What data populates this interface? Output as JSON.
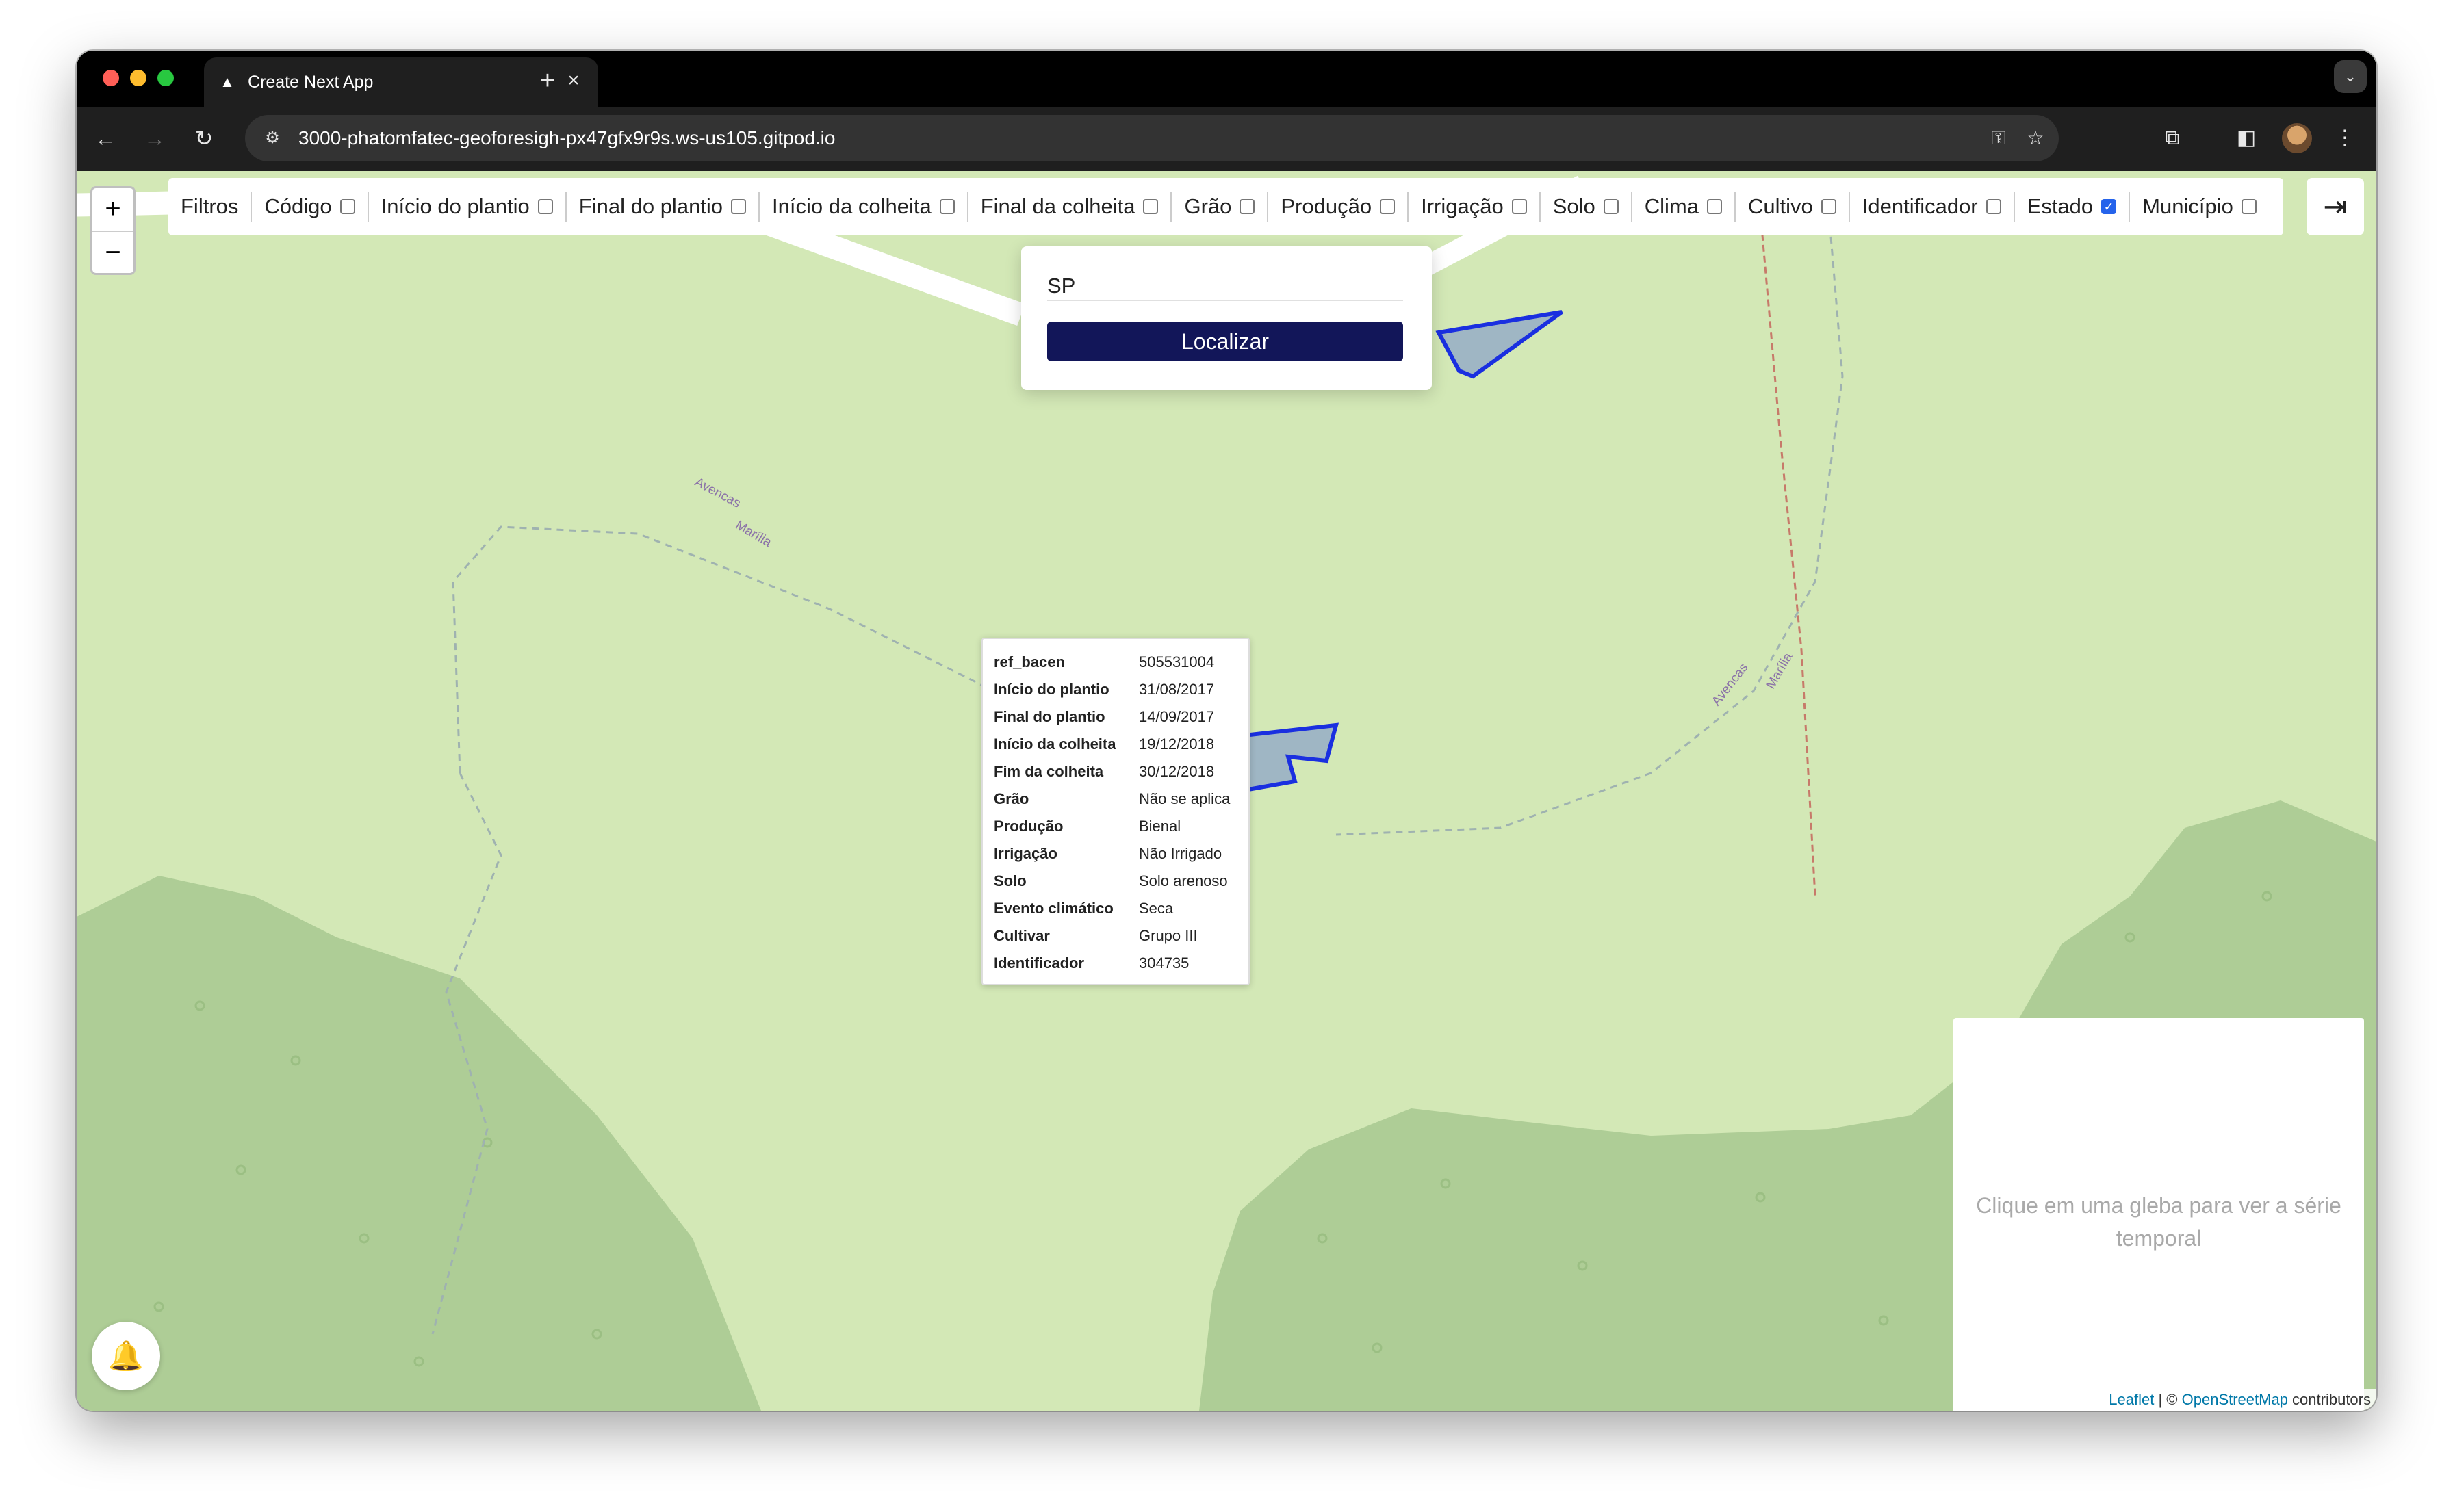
{
  "browser": {
    "tab_title": "Create Next App",
    "url": "3000-phatomfatec-geoforesigh-px47gfx9r9s.ws-us105.gitpod.io"
  },
  "map": {
    "zoom_in": "+",
    "zoom_out": "−",
    "filters_label": "Filtros",
    "filters": [
      {
        "label": "Código",
        "checked": false
      },
      {
        "label": "Início do plantio",
        "checked": false
      },
      {
        "label": "Final do plantio",
        "checked": false
      },
      {
        "label": "Início da colheita",
        "checked": false
      },
      {
        "label": "Final da colheita",
        "checked": false
      },
      {
        "label": "Grão",
        "checked": false
      },
      {
        "label": "Produção",
        "checked": false
      },
      {
        "label": "Irrigação",
        "checked": false
      },
      {
        "label": "Solo",
        "checked": false
      },
      {
        "label": "Clima",
        "checked": false
      },
      {
        "label": "Cultivo",
        "checked": false
      },
      {
        "label": "Identificador",
        "checked": false
      },
      {
        "label": "Estado",
        "checked": true
      },
      {
        "label": "Município",
        "checked": false
      }
    ],
    "search": {
      "value": "SP",
      "button": "Localizar"
    },
    "popup": {
      "rows": [
        {
          "key": "ref_bacen",
          "value": "505531004"
        },
        {
          "key": "Início do plantio",
          "value": "31/08/2017"
        },
        {
          "key": "Final do plantio",
          "value": "14/09/2017"
        },
        {
          "key": "Início da colheita",
          "value": "19/12/2018"
        },
        {
          "key": "Fim da colheita",
          "value": "30/12/2018"
        },
        {
          "key": "Grão",
          "value": "Não se aplica"
        },
        {
          "key": "Produção",
          "value": "Bienal"
        },
        {
          "key": "Irrigação",
          "value": "Não Irrigado"
        },
        {
          "key": "Solo",
          "value": "Solo arenoso"
        },
        {
          "key": "Evento climático",
          "value": "Seca"
        },
        {
          "key": "Cultivar",
          "value": "Grupo III"
        },
        {
          "key": "Identificador",
          "value": "304735"
        }
      ]
    },
    "chart_placeholder": "Clique em uma gleba para ver a série temporal",
    "attribution": {
      "leaflet": "Leaflet",
      "separator": " | © ",
      "osm": "OpenStreetMap",
      "suffix": " contributors"
    },
    "labels": {
      "avencas": "Avencas",
      "marilia": "Marília"
    },
    "colors": {
      "polygon_stroke": "#1a2fe0",
      "polygon_fill": "#9fb6c4",
      "forest": "#aecd96",
      "background": "#d3e8b6",
      "button": "#121659"
    }
  }
}
